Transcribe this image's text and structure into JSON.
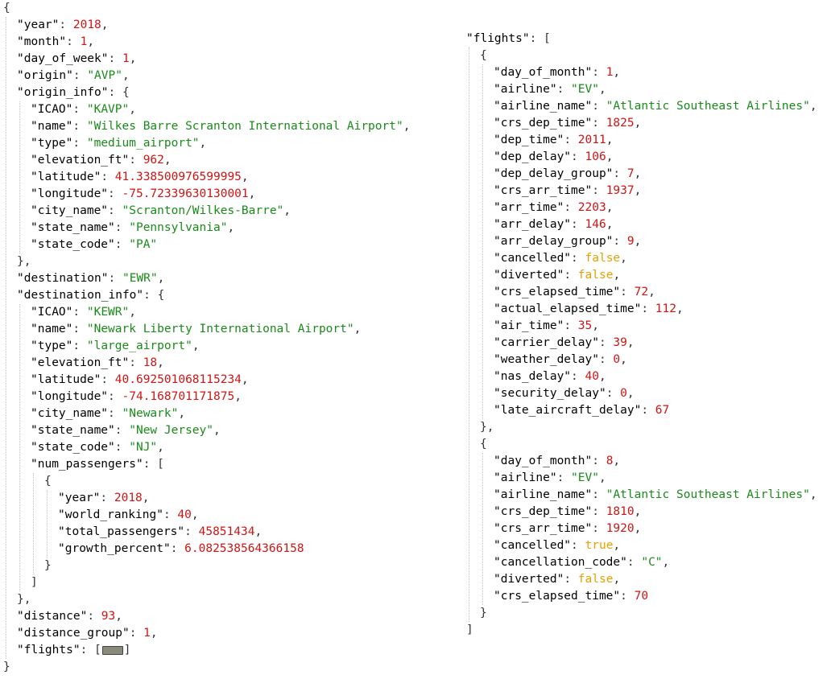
{
  "punct": {
    "open_brace": "{",
    "close_brace": "}",
    "close_brace_comma": "},",
    "open_bracket": "[",
    "close_bracket": "]",
    "colon": ": ",
    "comma": ","
  },
  "left": {
    "fields": {
      "year_k": "\"year\"",
      "year_v": "2018",
      "month_k": "\"month\"",
      "month_v": "1",
      "dow_k": "\"day_of_week\"",
      "dow_v": "1",
      "origin_k": "\"origin\"",
      "origin_v": "\"AVP\"",
      "origin_info_k": "\"origin_info\"",
      "oi_icao_k": "\"ICAO\"",
      "oi_icao_v": "\"KAVP\"",
      "oi_name_k": "\"name\"",
      "oi_name_v": "\"Wilkes Barre Scranton International Airport\"",
      "oi_type_k": "\"type\"",
      "oi_type_v": "\"medium_airport\"",
      "oi_elev_k": "\"elevation_ft\"",
      "oi_elev_v": "962",
      "oi_lat_k": "\"latitude\"",
      "oi_lat_v": "41.338500976599995",
      "oi_lon_k": "\"longitude\"",
      "oi_lon_v": "-75.72339630130001",
      "oi_city_k": "\"city_name\"",
      "oi_city_v": "\"Scranton/Wilkes-Barre\"",
      "oi_state_k": "\"state_name\"",
      "oi_state_v": "\"Pennsylvania\"",
      "oi_code_k": "\"state_code\"",
      "oi_code_v": "\"PA\"",
      "dest_k": "\"destination\"",
      "dest_v": "\"EWR\"",
      "dest_info_k": "\"destination_info\"",
      "di_icao_k": "\"ICAO\"",
      "di_icao_v": "\"KEWR\"",
      "di_name_k": "\"name\"",
      "di_name_v": "\"Newark Liberty International Airport\"",
      "di_type_k": "\"type\"",
      "di_type_v": "\"large_airport\"",
      "di_elev_k": "\"elevation_ft\"",
      "di_elev_v": "18",
      "di_lat_k": "\"latitude\"",
      "di_lat_v": "40.692501068115234",
      "di_lon_k": "\"longitude\"",
      "di_lon_v": "-74.168701171875",
      "di_city_k": "\"city_name\"",
      "di_city_v": "\"Newark\"",
      "di_state_k": "\"state_name\"",
      "di_state_v": "\"New Jersey\"",
      "di_code_k": "\"state_code\"",
      "di_code_v": "\"NJ\"",
      "np_k": "\"num_passengers\"",
      "np_year_k": "\"year\"",
      "np_year_v": "2018",
      "np_rank_k": "\"world_ranking\"",
      "np_rank_v": "40",
      "np_total_k": "\"total_passengers\"",
      "np_total_v": "45851434",
      "np_growth_k": "\"growth_percent\"",
      "np_growth_v": "6.082538564366158",
      "dist_k": "\"distance\"",
      "dist_v": "93",
      "distg_k": "\"distance_group\"",
      "distg_v": "1",
      "flights_k": "\"flights\""
    }
  },
  "right": {
    "flights_k": "\"flights\"",
    "f1": {
      "dom_k": "\"day_of_month\"",
      "dom_v": "1",
      "al_k": "\"airline\"",
      "al_v": "\"EV\"",
      "aln_k": "\"airline_name\"",
      "aln_v": "\"Atlantic Southeast Airlines\"",
      "cdt_k": "\"crs_dep_time\"",
      "cdt_v": "1825",
      "dt_k": "\"dep_time\"",
      "dt_v": "2011",
      "dd_k": "\"dep_delay\"",
      "dd_v": "106",
      "ddg_k": "\"dep_delay_group\"",
      "ddg_v": "7",
      "cat_k": "\"crs_arr_time\"",
      "cat_v": "1937",
      "at_k": "\"arr_time\"",
      "at_v": "2203",
      "ad_k": "\"arr_delay\"",
      "ad_v": "146",
      "adg_k": "\"arr_delay_group\"",
      "adg_v": "9",
      "can_k": "\"cancelled\"",
      "can_v": "false",
      "div_k": "\"diverted\"",
      "div_v": "false",
      "cet_k": "\"crs_elapsed_time\"",
      "cet_v": "72",
      "aet_k": "\"actual_elapsed_time\"",
      "aet_v": "112",
      "air_k": "\"air_time\"",
      "air_v": "35",
      "cd_k": "\"carrier_delay\"",
      "cd_v": "39",
      "wd_k": "\"weather_delay\"",
      "wd_v": "0",
      "nd_k": "\"nas_delay\"",
      "nd_v": "40",
      "sd_k": "\"security_delay\"",
      "sd_v": "0",
      "lad_k": "\"late_aircraft_delay\"",
      "lad_v": "67"
    },
    "f2": {
      "dom_k": "\"day_of_month\"",
      "dom_v": "8",
      "al_k": "\"airline\"",
      "al_v": "\"EV\"",
      "aln_k": "\"airline_name\"",
      "aln_v": "\"Atlantic Southeast Airlines\"",
      "cdt_k": "\"crs_dep_time\"",
      "cdt_v": "1810",
      "cat_k": "\"crs_arr_time\"",
      "cat_v": "1920",
      "can_k": "\"cancelled\"",
      "can_v": "true",
      "cc_k": "\"cancellation_code\"",
      "cc_v": "\"C\"",
      "div_k": "\"diverted\"",
      "div_v": "false",
      "cet_k": "\"crs_elapsed_time\"",
      "cet_v": "70"
    }
  },
  "icons": {
    "collapsed": "collapsed-ellipsis-icon"
  },
  "colors": {
    "key": "#000000",
    "string": "#1a8a1a",
    "number": "#d01414",
    "boolean": "#e6a000"
  }
}
